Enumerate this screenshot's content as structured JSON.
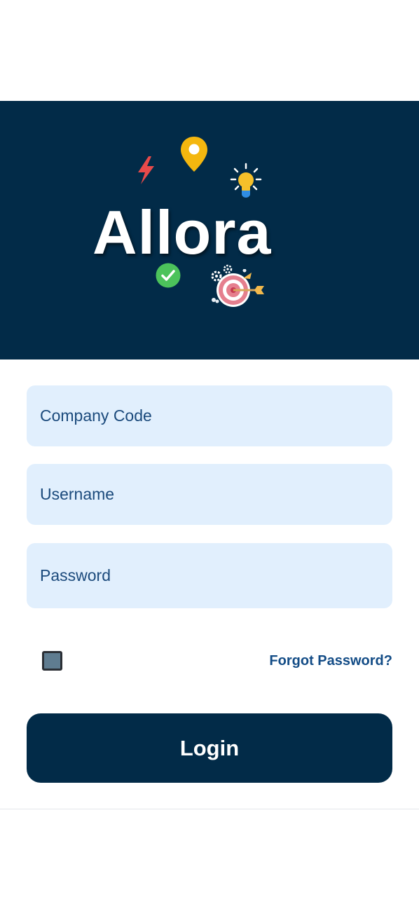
{
  "brand": {
    "name": "Allora"
  },
  "form": {
    "company_code": {
      "placeholder": "Company Code",
      "value": ""
    },
    "username": {
      "placeholder": "Username",
      "value": ""
    },
    "password": {
      "placeholder": "Password",
      "value": ""
    },
    "forgot_password_label": "Forgot Password?",
    "login_label": "Login"
  },
  "icons": [
    "lightning-icon",
    "map-pin-icon",
    "lightbulb-icon",
    "checkmark-icon",
    "gears-icon",
    "target-arrow-icon"
  ],
  "colors": {
    "hero_bg": "#022b48",
    "field_bg": "#e1effd",
    "field_text": "#1b4a7c",
    "link": "#134c86",
    "button_bg": "#022b48",
    "button_text": "#ffffff"
  }
}
